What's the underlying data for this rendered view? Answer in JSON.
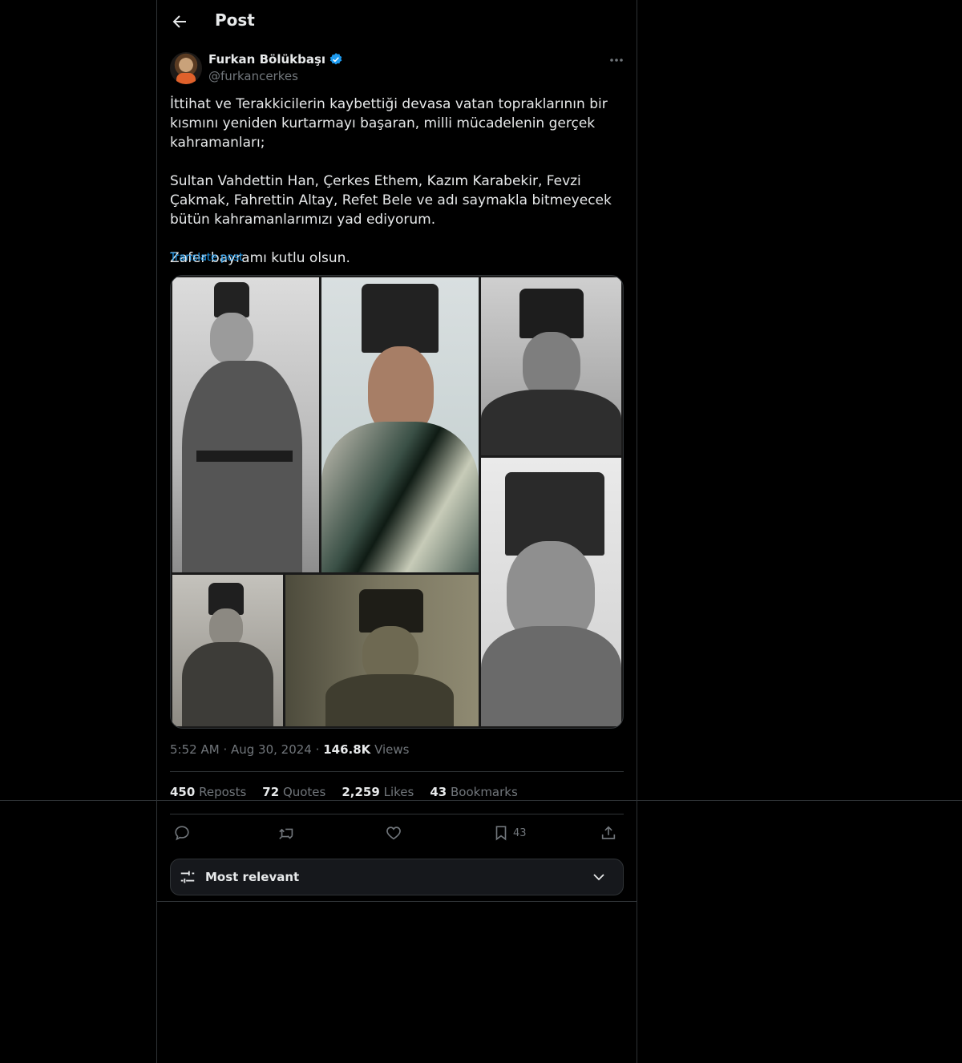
{
  "header": {
    "title": "Post"
  },
  "author": {
    "name": "Furkan Bölükbaşı",
    "handle": "@furkancerkes",
    "verified": true
  },
  "post": {
    "text": "İttihat ve Terakkicilerin kaybettiği devasa vatan topraklarının bir kısmını yeniden kurtarmayı başaran, milli mücadelenin gerçek kahramanları;\n\nSultan Vahdettin Han, Çerkes Ethem, Kazım Karabekir, Fevzi Çakmak, Fahrettin Altay, Refet Bele ve adı saymakla bitmeyecek bütün kahramanlarımızı yad ediyorum.\n\nZafer bayramı kutlu olsun.",
    "translate_label": "Translate post",
    "time": "5:52 AM",
    "dot": "·",
    "date": "Aug 30, 2024",
    "views_count": "146.8K",
    "views_label": "Views"
  },
  "stats": {
    "reposts_count": "450",
    "reposts_label": "Reposts",
    "quotes_count": "72",
    "quotes_label": "Quotes",
    "likes_count": "2,259",
    "likes_label": "Likes",
    "bookmarks_count": "43",
    "bookmarks_label": "Bookmarks"
  },
  "actions": {
    "bookmark_count": "43"
  },
  "sort": {
    "label": "Most relevant"
  },
  "colors": {
    "accent": "#1d9bf0",
    "background": "#000000",
    "muted": "#71767b",
    "border": "#2f3336"
  },
  "icons": [
    "back-arrow-icon",
    "verified-badge-icon",
    "more-icon",
    "reply-icon",
    "repost-icon",
    "like-icon",
    "bookmark-icon",
    "share-icon",
    "sliders-icon",
    "chevron-down-icon"
  ]
}
